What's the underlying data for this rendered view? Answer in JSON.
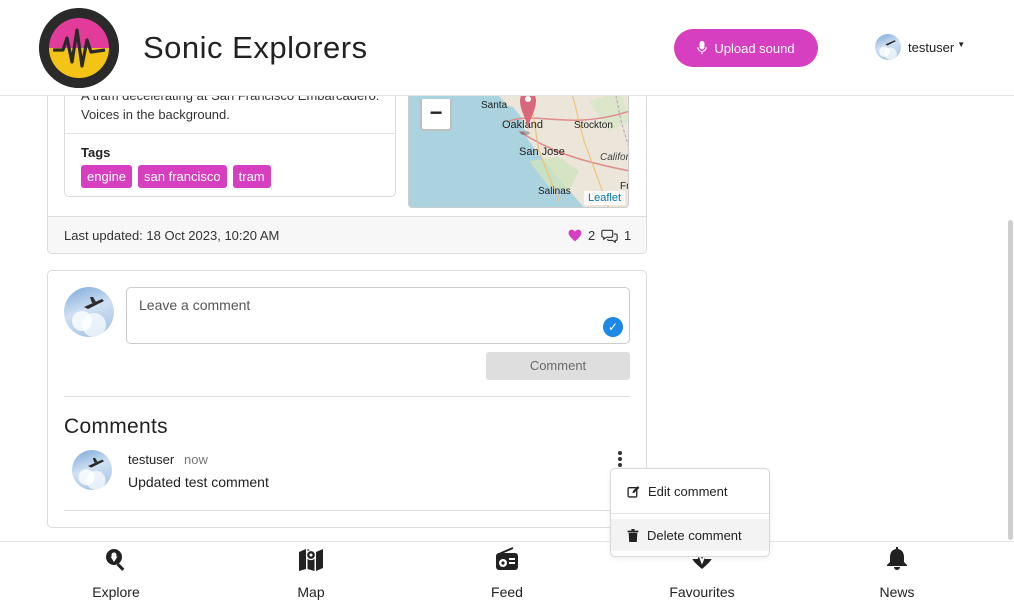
{
  "header": {
    "brand": "Sonic Explorers",
    "upload_label": "Upload sound",
    "username": "testuser"
  },
  "sound": {
    "description": "A tram decelerating at San Francisco Embarcadero. Voices in the background.",
    "tags_label": "Tags",
    "tags": [
      "engine",
      "san francisco",
      "tram"
    ],
    "last_updated": "Last updated: 18 Oct 2023, 10:20 AM",
    "likes": "2",
    "comments_count": "1",
    "map": {
      "zoom_out": "−",
      "attribution": "Leaflet",
      "labels": [
        "Santa",
        "Oakland",
        "Stockton",
        "San Jose",
        "Califor",
        "Salinas",
        "Fr"
      ]
    }
  },
  "comment_form": {
    "placeholder": "Leave a comment",
    "submit_label": "Comment"
  },
  "comments": {
    "heading": "Comments",
    "items": [
      {
        "author": "testuser",
        "time": "now",
        "text": "Updated test comment"
      }
    ]
  },
  "comment_menu": {
    "edit_label": "Edit comment",
    "delete_label": "Delete comment"
  },
  "bottom_nav": [
    {
      "label": "Explore",
      "icon": "search-location-icon"
    },
    {
      "label": "Map",
      "icon": "map-icon"
    },
    {
      "label": "Feed",
      "icon": "radio-icon"
    },
    {
      "label": "Favourites",
      "icon": "heart-pulse-icon"
    },
    {
      "label": "News",
      "icon": "bell-icon"
    }
  ],
  "colors": {
    "accent": "#d63fbf",
    "link": "#0078a8",
    "check_badge": "#1e88e5"
  }
}
